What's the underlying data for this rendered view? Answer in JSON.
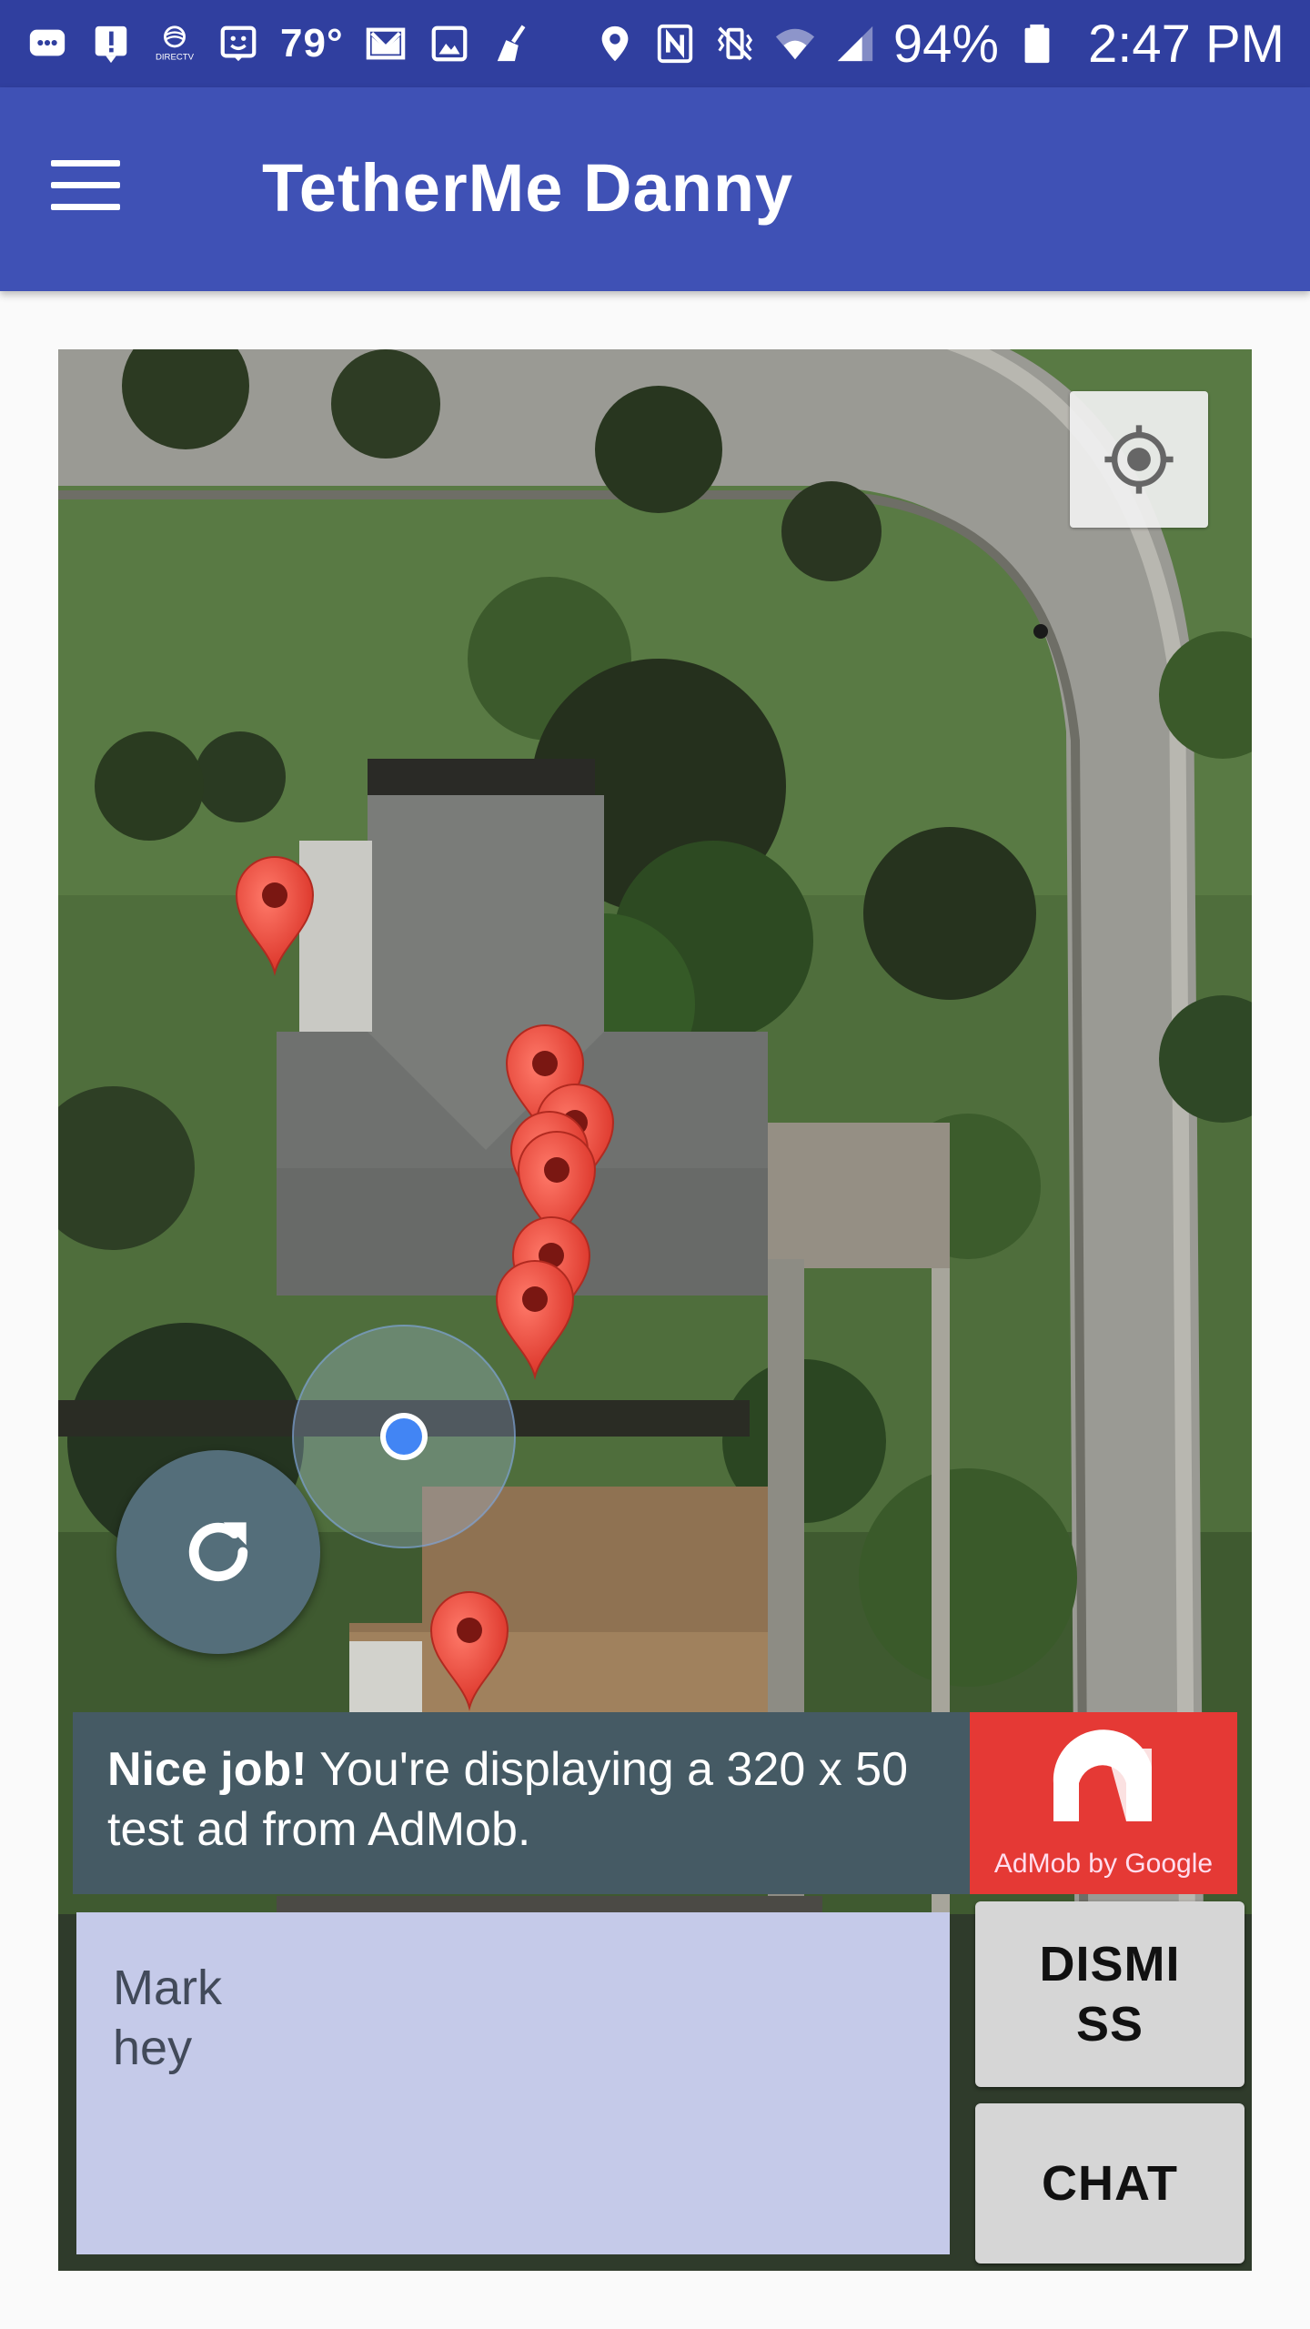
{
  "status_bar": {
    "temperature": "79°",
    "battery": "94%",
    "time": "2:47 PM",
    "carrier_icon_label": "DIRECTV",
    "icons": [
      "message-icon",
      "alert-icon",
      "directv-icon",
      "face-icon",
      "mail-icon",
      "image-icon",
      "broom-icon",
      "location-icon",
      "nfc-icon",
      "vibrate-icon",
      "wifi-icon",
      "signal-icon",
      "battery-icon"
    ]
  },
  "app_bar": {
    "title": "TetherMe Danny",
    "menu_icon": "hamburger-menu-icon"
  },
  "map": {
    "type": "satellite",
    "markers": 7,
    "my_location_button": "my-location-icon",
    "refresh_button": "refresh-icon"
  },
  "ad": {
    "bold": "Nice job!",
    "text": " You're displaying a 320 x 50 test ad from AdMob.",
    "logo_caption": "AdMob by Google"
  },
  "message": {
    "sender": "Mark",
    "text": "hey"
  },
  "buttons": {
    "dismiss": "DISMISS",
    "chat": "CHAT"
  },
  "colors": {
    "status_bar": "#303f9f",
    "app_bar": "#3f51b5",
    "ad_background": "#455a64",
    "admob_red": "#e53935",
    "message_background": "#c5cae9",
    "marker_red": "#ea4335",
    "location_dot": "#4285f4"
  }
}
